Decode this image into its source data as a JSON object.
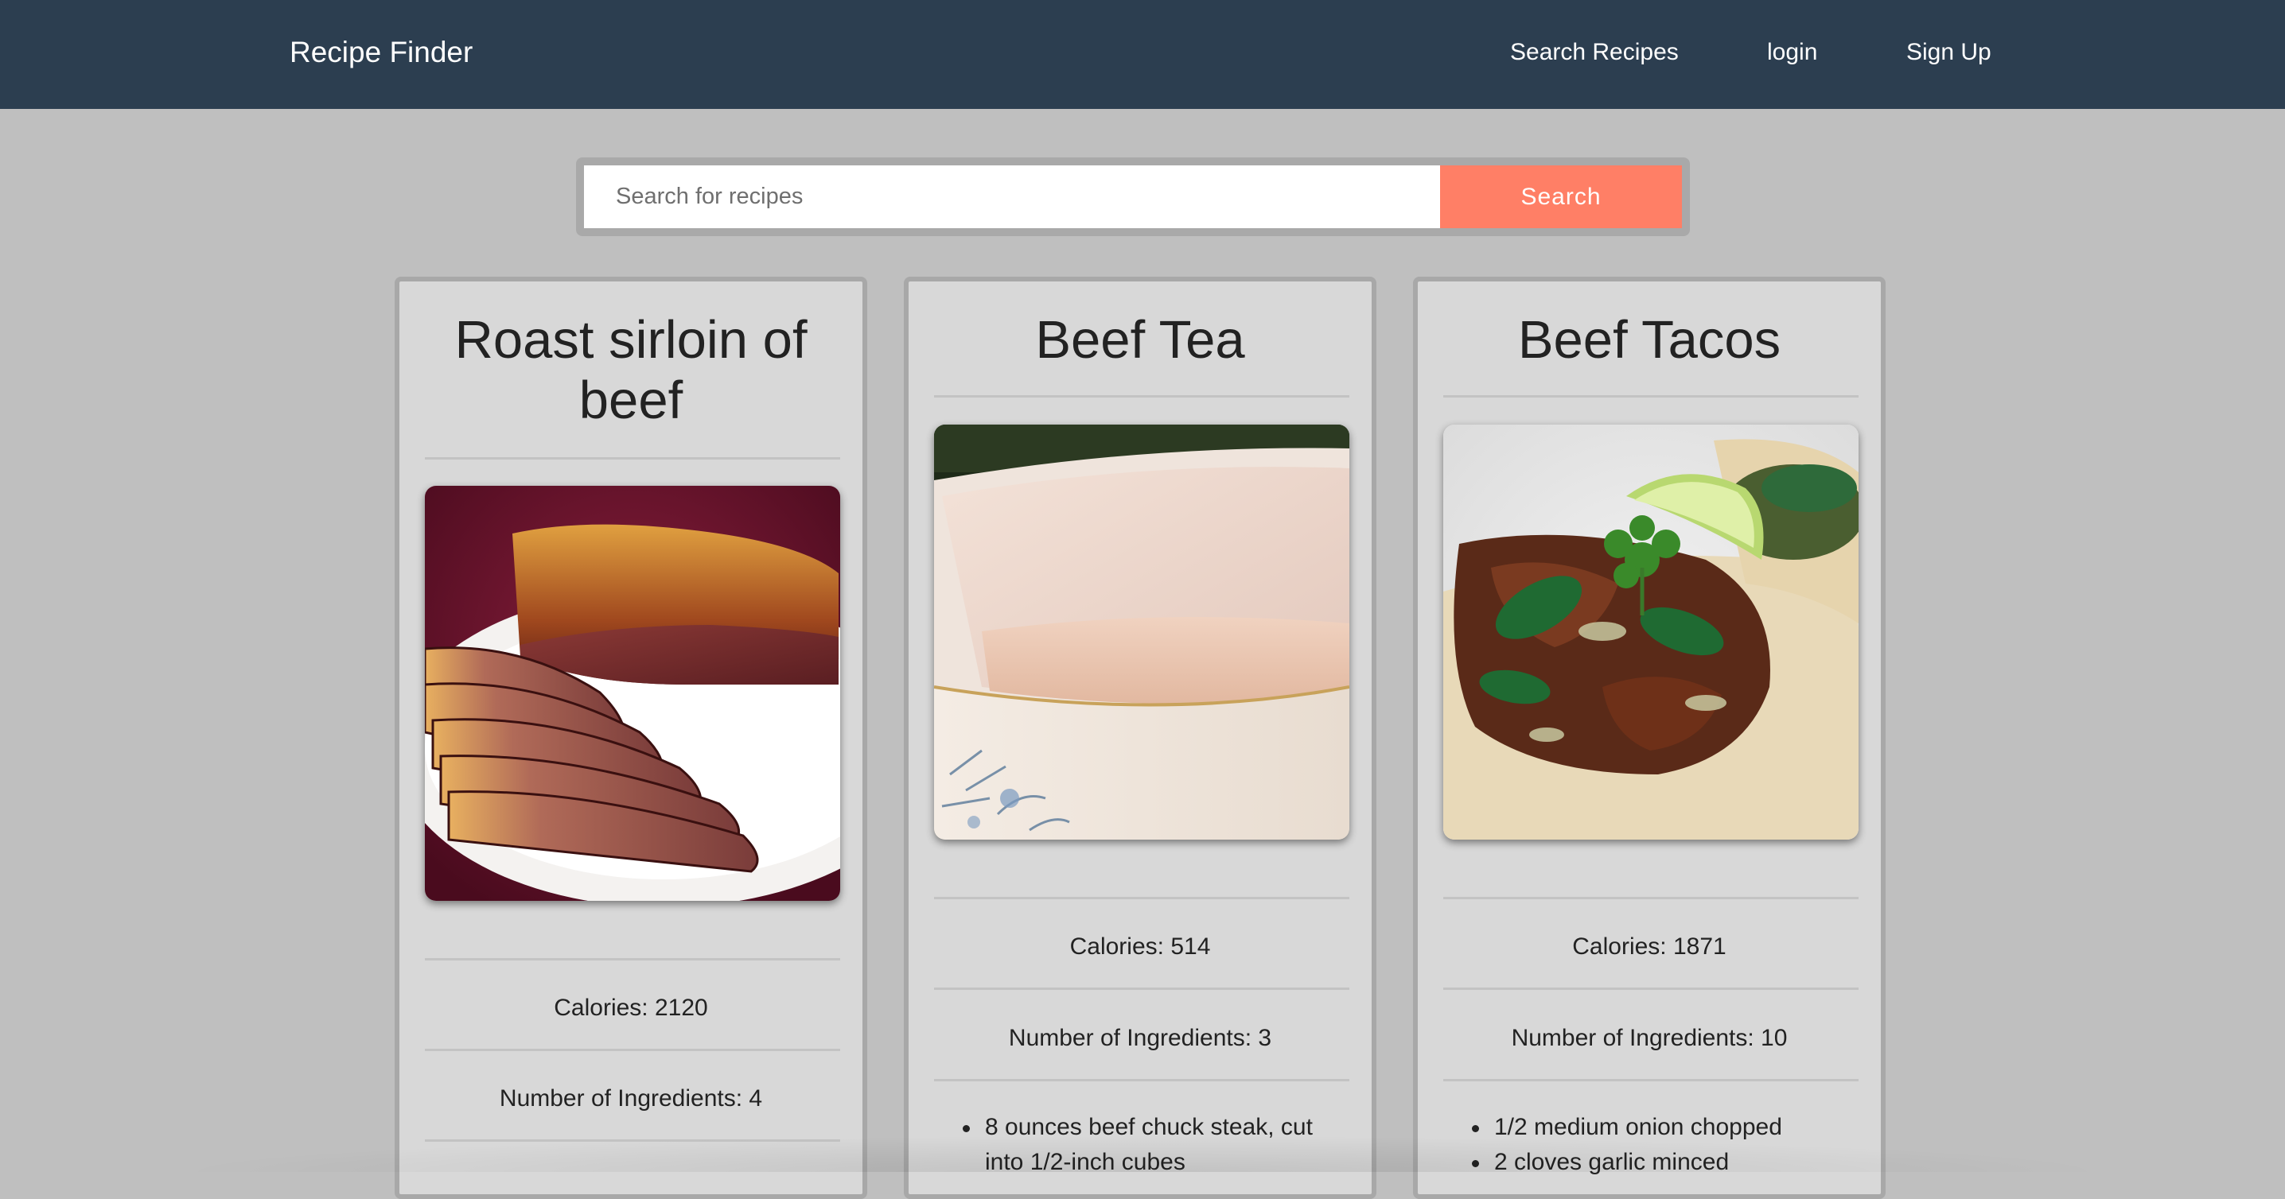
{
  "nav": {
    "brand": "Recipe Finder",
    "links": [
      "Search Recipes",
      "login",
      "Sign Up"
    ]
  },
  "search": {
    "placeholder": "Search for recipes",
    "button_label": "Search"
  },
  "recipes": [
    {
      "title": "Roast sirloin of beef",
      "image": "roast-beef-image",
      "calories": "Calories: 2120",
      "ingredients_count": "Number of Ingredients: 4",
      "ingredients": []
    },
    {
      "title": "Beef Tea",
      "image": "beef-tea-image",
      "calories": "Calories: 514",
      "ingredients_count": "Number of Ingredients: 3",
      "ingredients": [
        "8 ounces beef chuck steak, cut into 1/2-inch cubes"
      ]
    },
    {
      "title": "Beef Tacos",
      "image": "beef-tacos-image",
      "calories": "Calories: 1871",
      "ingredients_count": "Number of Ingredients: 10",
      "ingredients": [
        "1/2 medium onion chopped",
        "2 cloves garlic minced"
      ]
    }
  ],
  "colors": {
    "navbar": "#2c3e50",
    "page_bg": "#bfbfbf",
    "card_bg": "#d8d8d8",
    "search_button": "#ff7f66"
  }
}
